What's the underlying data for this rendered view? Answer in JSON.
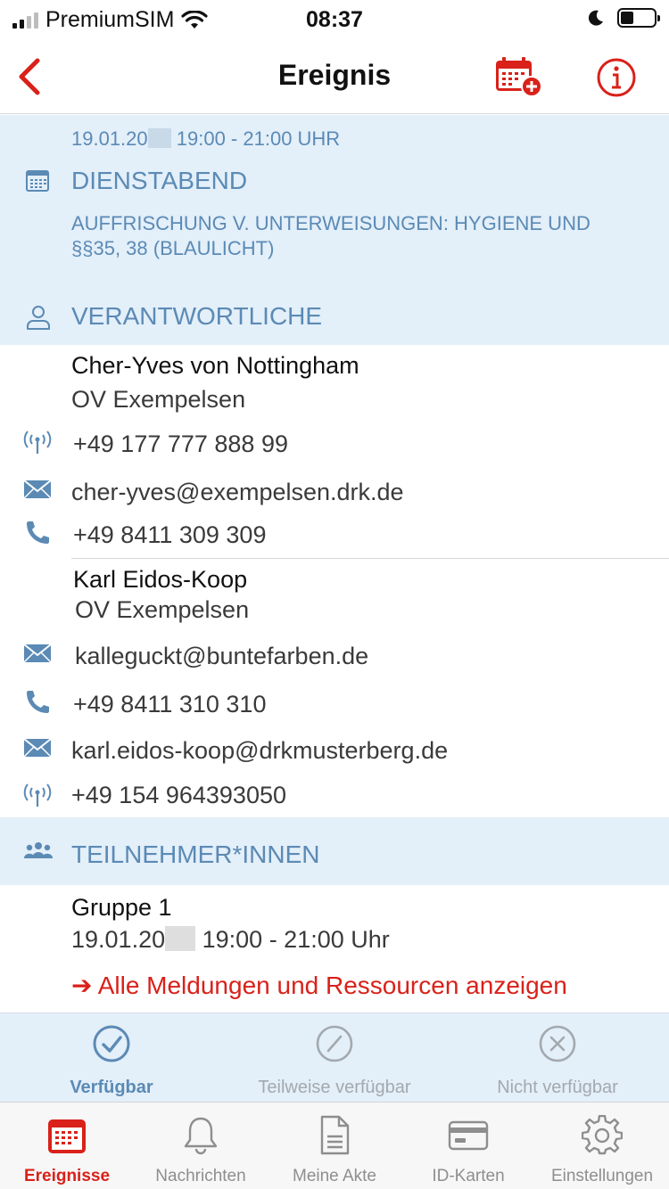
{
  "status": {
    "carrier": "PremiumSIM",
    "time": "08:37"
  },
  "nav": {
    "title": "Ereignis",
    "back_icon": "chevron-left-icon",
    "calendar_add_icon": "calendar-add-icon",
    "info_icon": "info-icon"
  },
  "event": {
    "date_prefix": "19.01.20",
    "time_range": "19:00 - 21:00 UHR",
    "category": "DIENSTABEND",
    "description": "AUFFRISCHUNG V. UNTERWEISUNGEN: HYGIENE UND §§35, 38 (BLAULICHT)"
  },
  "responsible": {
    "heading": "VERANTWORTLICHE",
    "people": [
      {
        "name": "Cher-Yves von Nottingham",
        "org": "OV Exempelsen",
        "mobile": "+49 177 777 888 99",
        "email": "cher-yves@exempelsen.drk.de",
        "phone": "+49 8411 309 309"
      },
      {
        "name": "Karl Eidos-Koop",
        "org": "OV Exempelsen",
        "email": "kalleguckt@buntefarben.de",
        "phone": "+49 8411 310 310",
        "email2": "karl.eidos-koop@drkmusterberg.de",
        "mobile": "+49 154 964393050"
      }
    ]
  },
  "participants": {
    "heading": "TEILNEHMER*INNEN",
    "group_name": "Gruppe 1",
    "group_date_prefix": "19.01.20",
    "group_time": "19:00 - 21:00 Uhr",
    "link": "➔ Alle Meldungen und Ressourcen anzeigen"
  },
  "availability": {
    "options": [
      {
        "label": "Verfügbar",
        "selected": true
      },
      {
        "label": "Teilweise verfügbar",
        "selected": false
      },
      {
        "label": "Nicht verfügbar",
        "selected": false
      }
    ]
  },
  "tabs": [
    {
      "label": "Ereignisse",
      "icon": "calendar-icon",
      "active": true
    },
    {
      "label": "Nachrichten",
      "icon": "bell-icon",
      "active": false
    },
    {
      "label": "Meine Akte",
      "icon": "document-icon",
      "active": false
    },
    {
      "label": "ID-Karten",
      "icon": "card-icon",
      "active": false
    },
    {
      "label": "Einstellungen",
      "icon": "gear-icon",
      "active": false
    }
  ],
  "colors": {
    "accent_red": "#d9211a",
    "section_blue": "#5b8ab5",
    "section_bg": "#e3eff9"
  }
}
